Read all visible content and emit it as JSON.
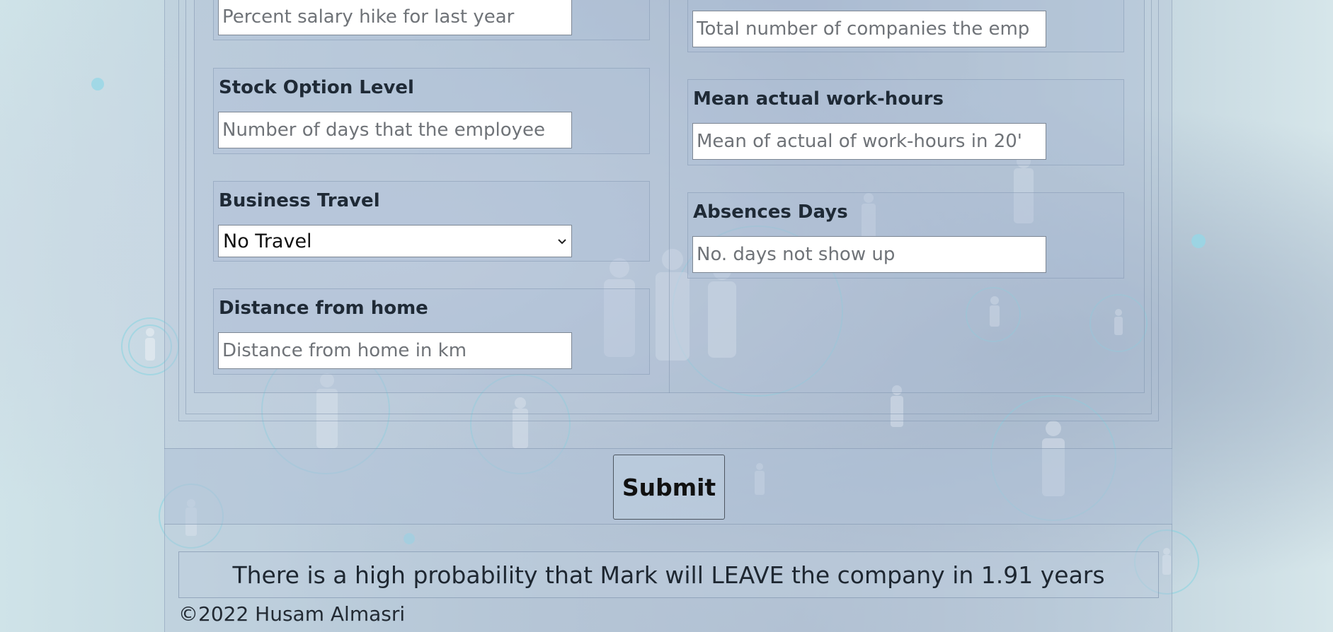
{
  "form": {
    "left": {
      "salary_hike": {
        "placeholder": "Percent salary hike for last year"
      },
      "stock_option": {
        "label": "Stock Option Level",
        "placeholder": "Number of days that the employee"
      },
      "business_travel": {
        "label": "Business Travel",
        "selected": "No Travel"
      },
      "distance_home": {
        "label": "Distance from home",
        "placeholder": "Distance from home in km"
      }
    },
    "right": {
      "num_companies": {
        "placeholder": "Total number of companies the emp"
      },
      "mean_hours": {
        "label": "Mean actual work-hours",
        "placeholder": "Mean of actual of work-hours in 20'"
      },
      "absences": {
        "label": "Absences Days",
        "placeholder": "No. days not show up"
      }
    }
  },
  "submit": {
    "label": "Submit"
  },
  "result": {
    "text": "There is a high probability that Mark will LEAVE the company in 1.91 years"
  },
  "footer": {
    "text": "©2022 Husam Almasri"
  },
  "icons": {
    "select_chevron": "chevron-down-icon"
  },
  "colors": {
    "label_text": "#1f2a36",
    "input_border": "#7d8794",
    "input_bg": "#ffffff"
  }
}
